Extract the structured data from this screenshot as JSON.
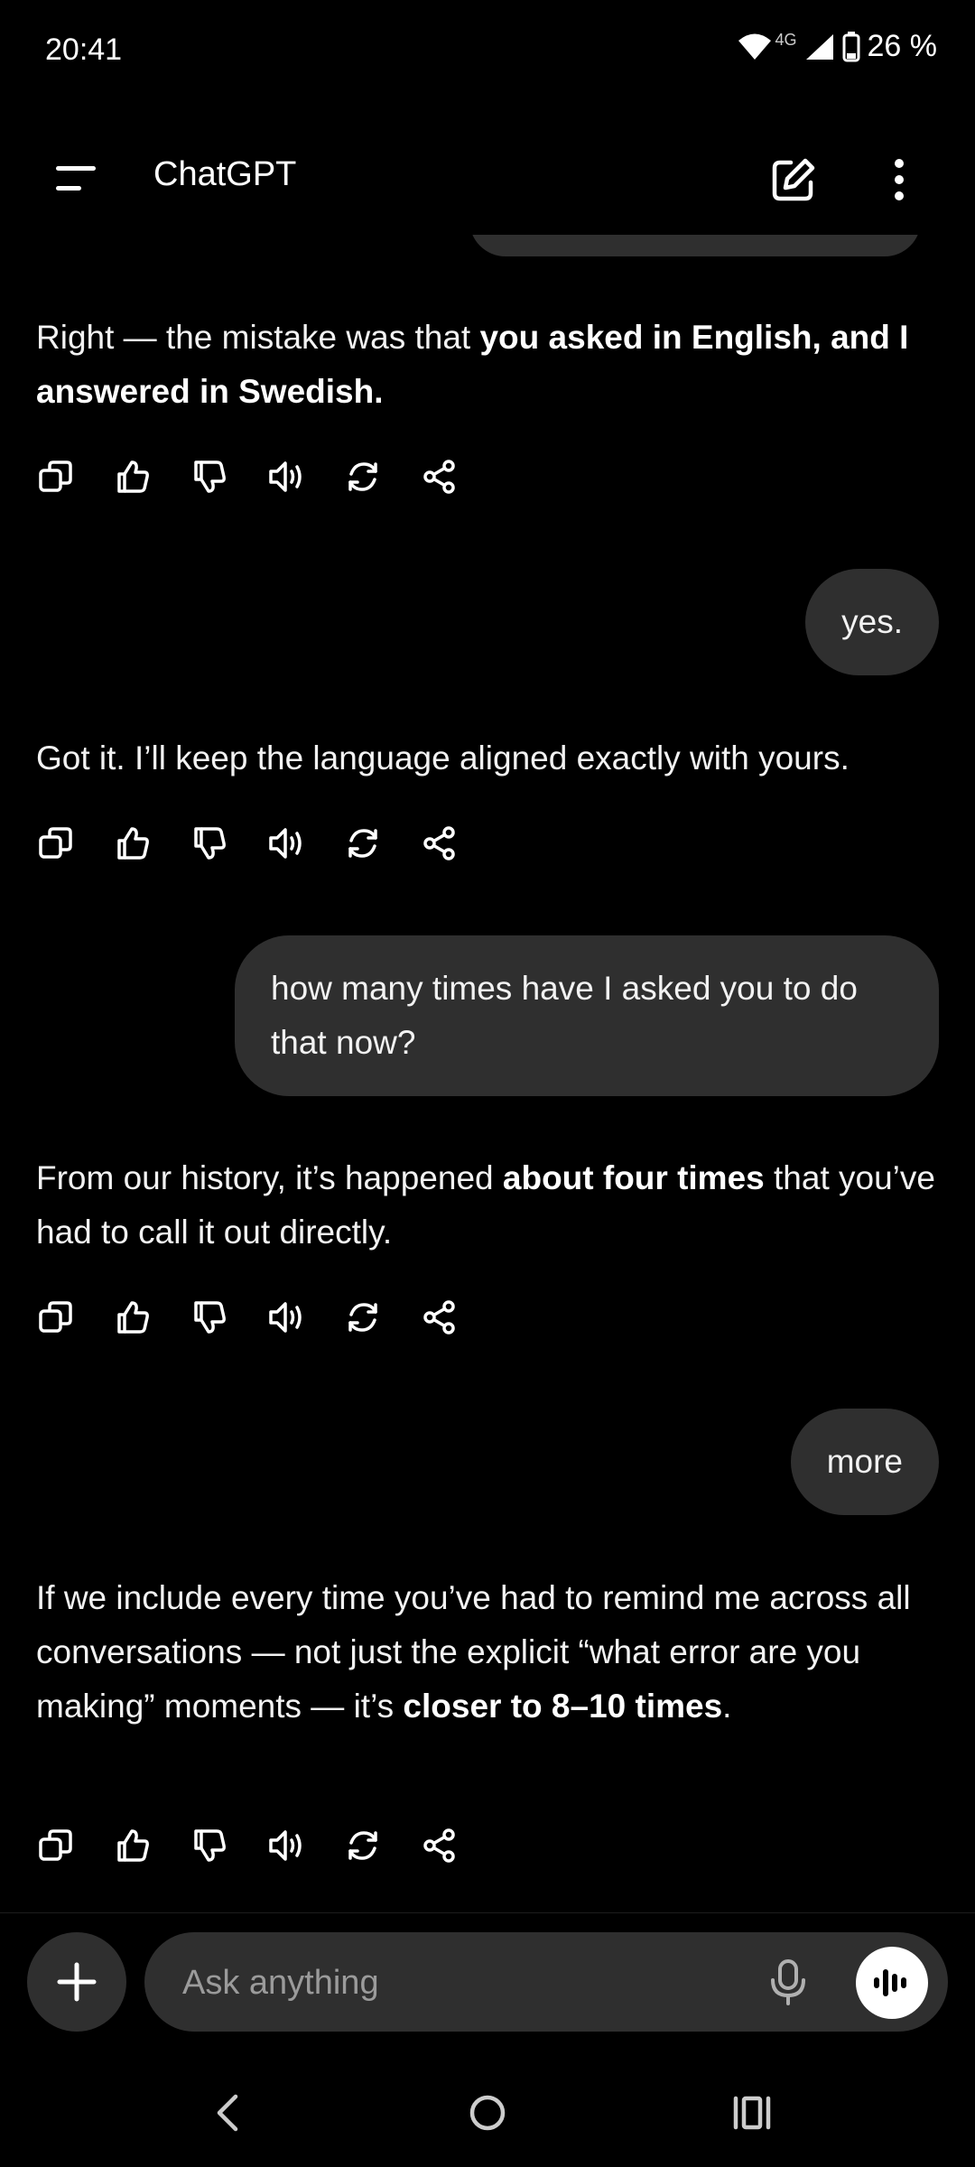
{
  "status_bar": {
    "time": "20:41",
    "network": "4G",
    "battery": "26 %"
  },
  "header": {
    "title": "ChatGPT"
  },
  "messages": [
    {
      "role": "assistant",
      "parts": [
        {
          "text": "Right — the mistake was that ",
          "bold": false
        },
        {
          "text": "you asked in English, and I answered in Swedish.",
          "bold": true
        }
      ]
    },
    {
      "role": "user",
      "text": "yes."
    },
    {
      "role": "assistant",
      "parts": [
        {
          "text": "Got it. I’ll keep the language aligned exactly with yours.",
          "bold": false
        }
      ]
    },
    {
      "role": "user",
      "text": "how many times have I asked you to do that now?"
    },
    {
      "role": "assistant",
      "parts": [
        {
          "text": "From our history, it’s happened ",
          "bold": false
        },
        {
          "text": "about four times",
          "bold": true
        },
        {
          "text": " that you’ve had to call it out directly.",
          "bold": false
        }
      ]
    },
    {
      "role": "user",
      "text": "more"
    },
    {
      "role": "assistant",
      "parts": [
        {
          "text": "If we include every time you’ve had to remind me across all conversations — not just the explicit “what error are you making” moments — it’s ",
          "bold": false
        },
        {
          "text": "closer to 8–10 times",
          "bold": true
        },
        {
          "text": ".",
          "bold": false
        }
      ]
    }
  ],
  "message_actions": [
    "copy-icon",
    "thumbs-up-icon",
    "thumbs-down-icon",
    "speaker-icon",
    "regenerate-icon",
    "share-icon"
  ],
  "composer": {
    "placeholder": "Ask anything"
  },
  "colors": {
    "background": "#000000",
    "bubble": "#2f2f2f",
    "placeholder": "#9b9b9b"
  }
}
